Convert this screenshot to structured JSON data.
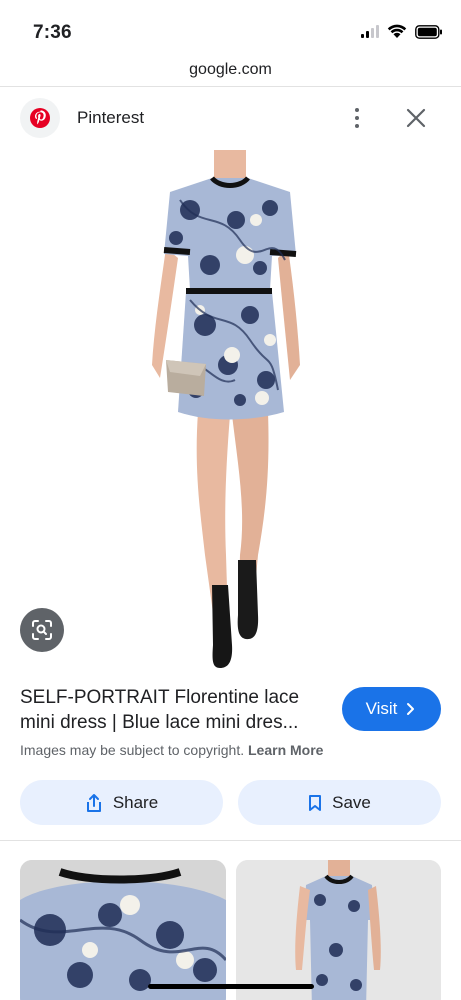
{
  "status_bar": {
    "time": "7:36"
  },
  "url_bar": {
    "domain": "google.com"
  },
  "source": {
    "name": "Pinterest",
    "logo_icon": "pinterest-logo-icon",
    "brand_color": "#e60023"
  },
  "result": {
    "title_line1": "SELF-PORTRAIT Florentine lace",
    "title_line2": "mini dress | Blue lace mini dres...",
    "visit_label": "Visit",
    "copyright_text": "Images may be subject to copyright.",
    "learn_more_label": "Learn More"
  },
  "actions": {
    "share_label": "Share",
    "save_label": "Save"
  },
  "colors": {
    "accent": "#1a73e8",
    "action_bg": "#e8f0fe",
    "dress_blue": "#a8b8d6",
    "lace_navy": "#1f2d55"
  }
}
